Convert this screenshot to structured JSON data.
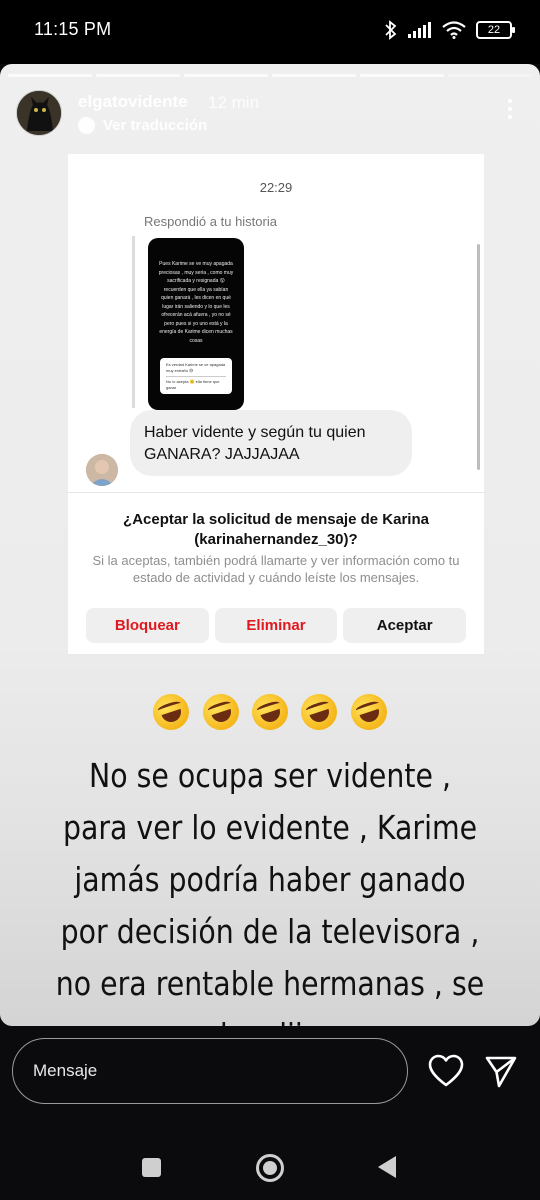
{
  "status_bar": {
    "time": "11:15 PM",
    "battery": "22"
  },
  "story": {
    "username": "elgatovidente",
    "time_ago": "12 min",
    "translate_label": "Ver traducción"
  },
  "dm_screenshot": {
    "time": "22:29",
    "replied_label": "Respondió a tu historia",
    "story_thumb_text": "Pues Karime se ve muy apagada preciosas , muy seria , como muy sacrificada y resignada 😮 recuerden que ella ya sabían quien ganará , les dicen en qué lugar irán saliendo y lo que les ofrecerán acá afuera , yo no sé pero pues si yo uno está y la energía de Karime dicen muchas cosas",
    "story_thumb_box_line1": "Es verdad Karime se ve apagada muy extraño 😅",
    "story_thumb_box_line2": "No lo acepta 🙂 ella tiene que ganar",
    "message": "Haber vidente y según tu quien GANARA? JAJJAJAA",
    "request_title": "¿Aceptar la solicitud de mensaje de Karina (karinahernandez_30)?",
    "request_desc": "Si la aceptas, también podrá llamarte y ver información como tu estado de actividad y cuándo leíste los mensajes.",
    "buttons": {
      "block": "Bloquear",
      "delete": "Eliminar",
      "accept": "Aceptar"
    }
  },
  "caption": {
    "emoji_icon": "rolling-on-floor-laughing-emoji x5",
    "text": "No se ocupa ser vidente , para ver lo evidente , Karime jamás podría haber ganado por decisión de la televisora , no era rentable hermanas , se les dijo"
  },
  "reply_bar": {
    "placeholder": "Mensaje"
  },
  "colors": {
    "danger": "#e0191e",
    "story_bg": "#efefef",
    "app_bg": "#0b0b0d"
  }
}
